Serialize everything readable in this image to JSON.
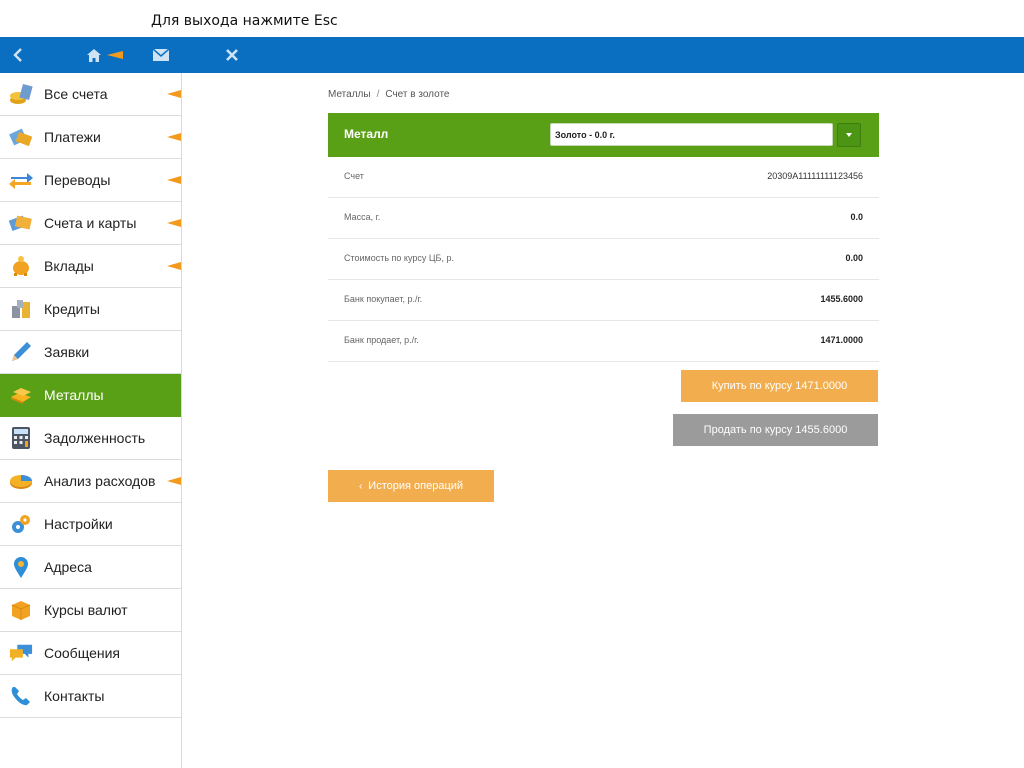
{
  "hint": "Для выхода нажмите Esc",
  "topbar": {
    "icons": [
      "back-icon",
      "home-icon",
      "mail-icon",
      "close-icon"
    ],
    "color": "#0a6fc0"
  },
  "sidebar": {
    "items": [
      {
        "label": "Все счета",
        "icon": "coins-icon"
      },
      {
        "label": "Платежи",
        "icon": "wallet-icon"
      },
      {
        "label": "Переводы",
        "icon": "transfer-arrows-icon"
      },
      {
        "label": "Счета и карты",
        "icon": "cards-icon"
      },
      {
        "label": "Вклады",
        "icon": "piggy-bank-icon"
      },
      {
        "label": "Кредиты",
        "icon": "credit-coins-icon"
      },
      {
        "label": "Заявки",
        "icon": "pencil-icon"
      },
      {
        "label": "Металлы",
        "icon": "gold-bars-icon"
      },
      {
        "label": "Задолженность",
        "icon": "calculator-icon"
      },
      {
        "label": "Анализ расходов",
        "icon": "pie-chart-icon"
      },
      {
        "label": "Настройки",
        "icon": "gears-icon"
      },
      {
        "label": "Адреса",
        "icon": "map-pin-icon"
      },
      {
        "label": "Курсы валют",
        "icon": "currency-box-icon"
      },
      {
        "label": "Сообщения",
        "icon": "chat-bubbles-icon"
      },
      {
        "label": "Контакты",
        "icon": "phone-icon"
      }
    ],
    "active_color": "#5aa017",
    "arrow_color": "#f29a1d"
  },
  "breadcrumb": {
    "parent": "Металлы",
    "separator": "/",
    "current": "Счет в золоте"
  },
  "panel": {
    "label": "Металл",
    "select_value": "Золото - 0.0 г."
  },
  "rows": [
    {
      "label": "Счет",
      "value": "20309A11111111123456"
    },
    {
      "label": "Масса, г.",
      "value": "0.0"
    },
    {
      "label": "Стоимость по курсу ЦБ, р.",
      "value": "0.00"
    },
    {
      "label": "Банк покупает, р./г.",
      "value": "1455.6000"
    },
    {
      "label": "Банк продает, р./г.",
      "value": "1471.0000"
    }
  ],
  "buttons": {
    "buy": "Купить по курсу 1471.0000",
    "sell": "Продать по курсу 1455.6000",
    "history": "История операций"
  }
}
